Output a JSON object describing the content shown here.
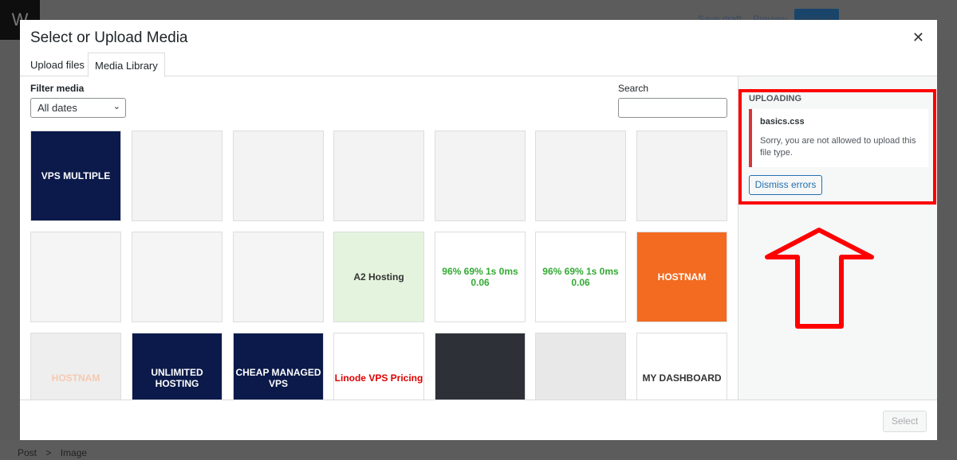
{
  "background": {
    "save_draft": "Save draft",
    "preview": "Preview",
    "publish": "Publish",
    "breadcrumb": [
      "Post",
      "Image"
    ],
    "breadcrumb_sep": ">"
  },
  "modal": {
    "title": "Select or Upload Media",
    "close_icon": "close-icon",
    "tabs": [
      {
        "label": "Upload files"
      },
      {
        "label": "Media Library",
        "active": true
      }
    ],
    "filter_label": "Filter media",
    "filter_value": "All dates",
    "search_label": "Search",
    "search_value": "",
    "thumbnails": [
      {
        "label": "VPS MULTIPLE",
        "bg": "#0b1a4a",
        "fg": "#fff"
      },
      {
        "label": "",
        "bg": "#f3f3f3",
        "fg": "#333"
      },
      {
        "label": "",
        "bg": "#f3f3f3",
        "fg": "#333"
      },
      {
        "label": "",
        "bg": "#f3f3f3",
        "fg": "#333"
      },
      {
        "label": "",
        "bg": "#f3f3f3",
        "fg": "#333"
      },
      {
        "label": "",
        "bg": "#f3f3f3",
        "fg": "#333"
      },
      {
        "label": "",
        "bg": "#f3f3f3",
        "fg": "#333"
      },
      {
        "label": "",
        "bg": "#f5f5f5",
        "fg": "#333"
      },
      {
        "label": "",
        "bg": "#f5f5f5",
        "fg": "#333"
      },
      {
        "label": "",
        "bg": "#f5f5f5",
        "fg": "#333"
      },
      {
        "label": "A2 Hosting",
        "bg": "#e4f3dd",
        "fg": "#333"
      },
      {
        "label": "96%  69%  1s  0ms  0.06",
        "bg": "#fff",
        "fg": "#3a3"
      },
      {
        "label": "96%  69%  1s  0ms  0.06",
        "bg": "#fff",
        "fg": "#3a3"
      },
      {
        "label": "HOSTNAM",
        "bg": "#f26b21",
        "fg": "#fff"
      },
      {
        "label": "HOSTNAM",
        "bg": "#eee",
        "fg": "#f6c9b0"
      },
      {
        "label": "UNLIMITED HOSTING",
        "bg": "#0b1a4a",
        "fg": "#fff"
      },
      {
        "label": "CHEAP MANAGED VPS",
        "bg": "#0b1a4a",
        "fg": "#fff"
      },
      {
        "label": "Linode VPS Pricing",
        "bg": "#fff",
        "fg": "#d00"
      },
      {
        "label": "",
        "bg": "#2d3137",
        "fg": "#fff"
      },
      {
        "label": "",
        "bg": "#e8e8e8",
        "fg": "#333"
      },
      {
        "label": "MY DASHBOARD",
        "bg": "#fff",
        "fg": "#333"
      }
    ],
    "sidebar": {
      "heading": "UPLOADING",
      "file": "basics.css",
      "message": "Sorry, you are not allowed to upload this file type.",
      "dismiss": "Dismiss errors"
    },
    "select_button": "Select"
  },
  "colors": {
    "error": "#d63638",
    "accent": "#2271b1",
    "highlight": "#ff0000"
  }
}
